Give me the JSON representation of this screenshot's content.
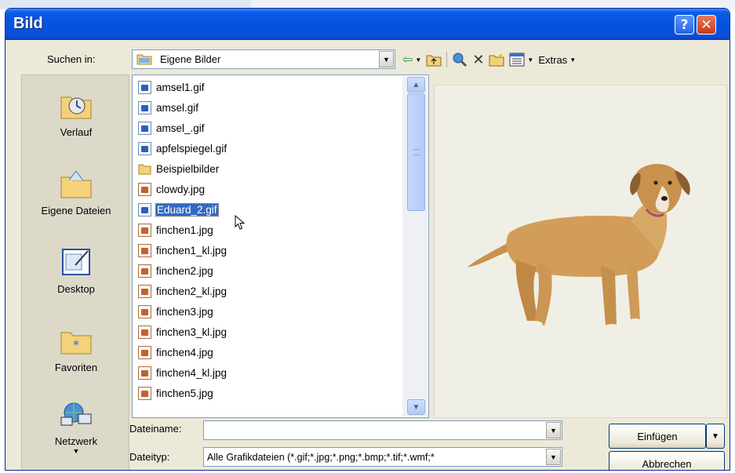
{
  "window": {
    "title": "Bild",
    "help_label": "?",
    "close_label": "✕"
  },
  "lookin": {
    "label": "Suchen in:",
    "value": "Eigene Bilder"
  },
  "toolbar": {
    "extras_label": "Extras"
  },
  "places": [
    {
      "label": "Verlauf",
      "icon": "history-icon"
    },
    {
      "label": "Eigene Dateien",
      "icon": "my-documents-icon"
    },
    {
      "label": "Desktop",
      "icon": "desktop-icon"
    },
    {
      "label": "Favoriten",
      "icon": "favorites-icon"
    },
    {
      "label": "Netzwerk",
      "icon": "network-icon"
    }
  ],
  "files": [
    {
      "name": "amsel1.gif",
      "type": "gif"
    },
    {
      "name": "amsel.gif",
      "type": "gif"
    },
    {
      "name": "amsel_.gif",
      "type": "gif"
    },
    {
      "name": "apfelspiegel.gif",
      "type": "gif"
    },
    {
      "name": "Beispielbilder",
      "type": "folder"
    },
    {
      "name": "clowdy.jpg",
      "type": "jpg"
    },
    {
      "name": "Eduard_2.gif",
      "type": "gif",
      "selected": true
    },
    {
      "name": "finchen1.jpg",
      "type": "jpg"
    },
    {
      "name": "finchen1_kl.jpg",
      "type": "jpg"
    },
    {
      "name": "finchen2.jpg",
      "type": "jpg"
    },
    {
      "name": "finchen2_kl.jpg",
      "type": "jpg"
    },
    {
      "name": "finchen3.jpg",
      "type": "jpg"
    },
    {
      "name": "finchen3_kl.jpg",
      "type": "jpg"
    },
    {
      "name": "finchen4.jpg",
      "type": "jpg"
    },
    {
      "name": "finchen4_kl.jpg",
      "type": "jpg"
    },
    {
      "name": "finchen5.jpg",
      "type": "jpg"
    }
  ],
  "filename": {
    "label": "Dateiname:",
    "value": ""
  },
  "filetype": {
    "label": "Dateityp:",
    "value": "Alle Grafikdateien (*.gif;*.jpg;*.png;*.bmp;*.tif;*.wmf;*"
  },
  "buttons": {
    "insert_label": "Einfügen",
    "cancel_label": "Abbrechen"
  },
  "colors": {
    "titlebar": "#0553e1",
    "dialog_bg": "#ece9d8",
    "selection": "#316ac5"
  }
}
